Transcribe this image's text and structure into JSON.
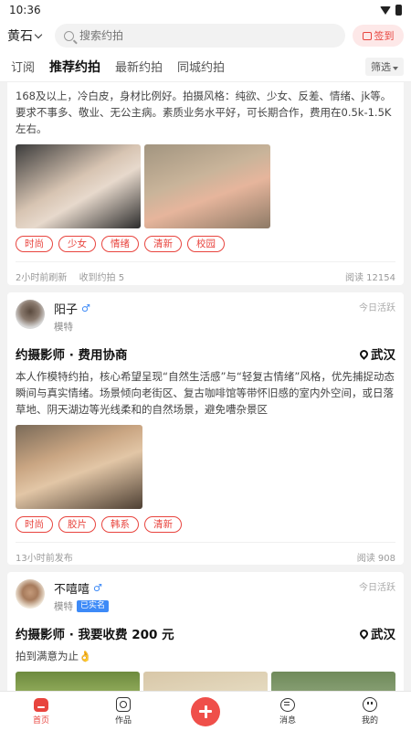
{
  "status": {
    "time": "10:36"
  },
  "header": {
    "city": "黄石",
    "search_placeholder": "搜索约拍",
    "signin_label": "签到"
  },
  "tabs": [
    {
      "label": "订阅"
    },
    {
      "label": "推荐约拍"
    },
    {
      "label": "最新约拍"
    },
    {
      "label": "同城约拍"
    }
  ],
  "filter_label": "筛选",
  "posts": [
    {
      "body": "168及以上，冷白皮，身材比例好。拍摄风格：纯欲、少女、反差、情绪、jk等。要求不事多、敬业、无公主病。素质业务水平好，可长期合作，费用在0.5k-1.5K左右。",
      "tags": [
        "时尚",
        "少女",
        "情绪",
        "清新",
        "校园"
      ],
      "time": "2小时前刷新",
      "saves": "收到约拍 5",
      "views": "阅读 12154"
    },
    {
      "name": "阳子",
      "role": "模特",
      "activity": "今日活跃",
      "title": "约摄影师 · 费用协商",
      "city": "武汉",
      "body": "本人作模特约拍，核心希望呈现“自然生活感”与“轻复古情绪”风格，优先捕捉动态瞬间与真实情绪。场景倾向老街区、复古咖啡馆等带怀旧感的室内外空间，或日落草地、阴天湖边等光线柔和的自然场景，避免嘈杂景区",
      "tags": [
        "时尚",
        "胶片",
        "韩系",
        "清新"
      ],
      "time": "13小时前发布",
      "views": "阅读 908"
    },
    {
      "name": "不嘻嘻",
      "role": "模特",
      "badge": "已实名",
      "activity": "今日活跃",
      "title": "约摄影师 · 我要收费 200 元",
      "city": "武汉",
      "body": "拍到满意为止👌"
    }
  ],
  "nav": [
    {
      "label": "首页"
    },
    {
      "label": "作品"
    },
    {
      "label": "消息"
    },
    {
      "label": "我的"
    }
  ]
}
